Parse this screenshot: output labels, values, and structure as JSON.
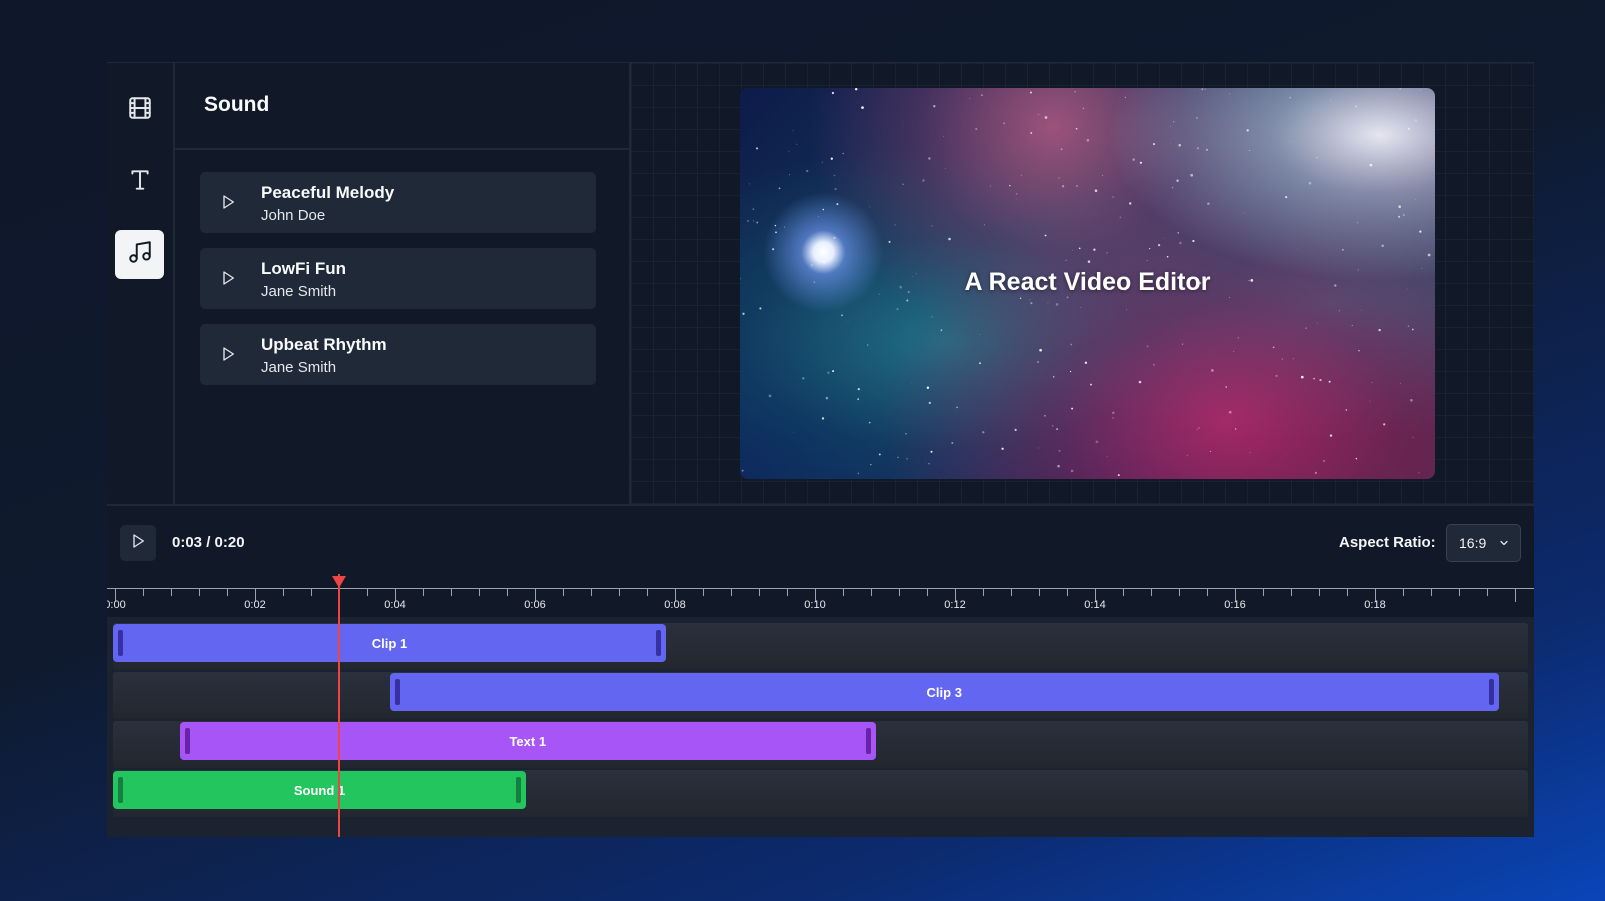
{
  "sidebar": {
    "items": [
      {
        "icon": "film-icon",
        "active": false
      },
      {
        "icon": "text-icon",
        "active": false
      },
      {
        "icon": "music-icon",
        "active": true
      }
    ]
  },
  "panel": {
    "title": "Sound",
    "tracks": [
      {
        "name": "Peaceful Melody",
        "artist": "John Doe"
      },
      {
        "name": "LowFi Fun",
        "artist": "Jane Smith"
      },
      {
        "name": "Upbeat Rhythm",
        "artist": "Jane Smith"
      }
    ]
  },
  "preview": {
    "overlay_text": "A React Video Editor"
  },
  "controls": {
    "time": "0:03 / 0:20",
    "aspect_label": "Aspect Ratio:",
    "aspect_value": "16:9"
  },
  "timeline": {
    "labels": [
      "0:00",
      "0:02",
      "0:04",
      "0:06",
      "0:08",
      "0:10",
      "0:12",
      "0:14",
      "0:16",
      "0:18"
    ],
    "duration_seconds": 20,
    "playhead_seconds": 3.2,
    "clips": [
      {
        "label": "Clip 1",
        "kind": "video",
        "lane": 0,
        "start": 0,
        "end": 7.9
      },
      {
        "label": "Clip 3",
        "kind": "video",
        "lane": 1,
        "start": 3.95,
        "end": 19.8
      },
      {
        "label": "Text 1",
        "kind": "text",
        "lane": 2,
        "start": 0.95,
        "end": 10.9
      },
      {
        "label": "Sound 1",
        "kind": "sound",
        "lane": 3,
        "start": 0,
        "end": 5.9
      }
    ]
  },
  "colors": {
    "video_clip": "#6366f1",
    "text_clip": "#a855f7",
    "sound_clip": "#22c55e",
    "playhead": "#ef4444"
  }
}
